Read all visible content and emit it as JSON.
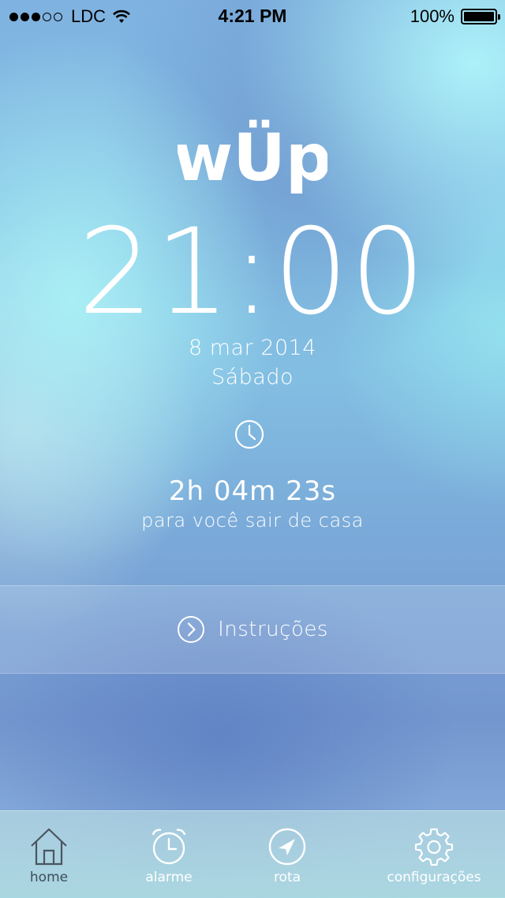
{
  "status_bar": {
    "carrier": "LDC",
    "time": "4:21 PM",
    "battery": "100%",
    "signal_bars_filled": 3,
    "signal_bars_total": 5
  },
  "app": {
    "logo_text": "wÜp"
  },
  "clock": {
    "time": "21:00",
    "date": "8 mar 2014",
    "weekday": "Sábado"
  },
  "countdown": {
    "value": "2h 04m 23s",
    "caption": "para você sair de casa"
  },
  "instructions": {
    "label": "Instruções",
    "icon": "chevron-right-circle-icon"
  },
  "tab_bar": {
    "active": "home",
    "tabs": [
      {
        "id": "home",
        "label": "home",
        "icon": "home-icon"
      },
      {
        "id": "alarme",
        "label": "alarme",
        "icon": "alarm-clock-icon"
      },
      {
        "id": "rota",
        "label": "rota",
        "icon": "navigation-arrow-icon"
      },
      {
        "id": "configuracoes",
        "label": "configurações",
        "icon": "gear-icon"
      }
    ]
  },
  "colors": {
    "text": "#ffffff",
    "active_tab": "#3e4e5a",
    "background_light": "#aef0f5",
    "background_dark": "#6f92cc"
  }
}
